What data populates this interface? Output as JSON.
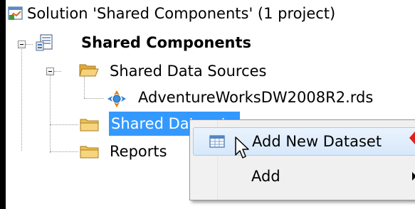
{
  "tree": {
    "solution_label": "Solution 'Shared Components' (1 project)",
    "project_label": "Shared Components",
    "shared_data_sources_label": "Shared Data Sources",
    "data_source_file": "AdventureWorksDW2008R2.rds",
    "shared_datasets_label": "Shared Datasets",
    "reports_label": "Reports"
  },
  "context_menu": {
    "items": [
      {
        "label": "Add New Dataset",
        "icon": "dataset-table-icon",
        "highlighted": true
      },
      {
        "label": "Add",
        "icon": "",
        "has_submenu": true
      }
    ]
  },
  "colors": {
    "selection": "#3399ff",
    "folder": "#f2c14e",
    "menu_highlight": "#d6e8fb",
    "annotation_arrow": "#e02020"
  }
}
